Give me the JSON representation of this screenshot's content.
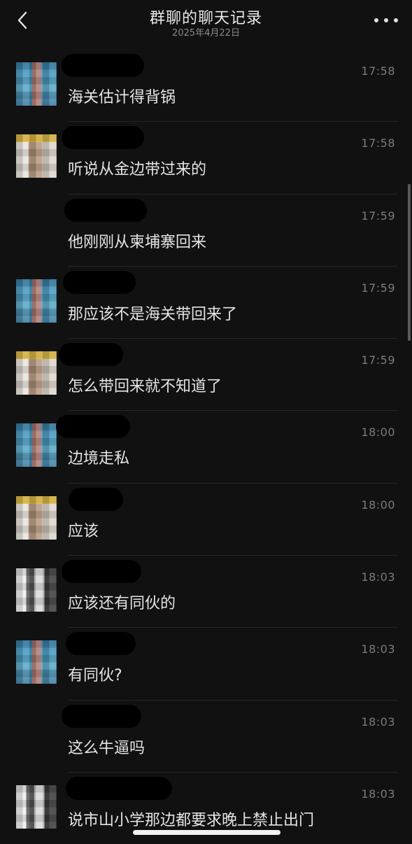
{
  "header": {
    "title": "群聊的聊天记录",
    "date": "2025年4月22日",
    "back_icon": "chevron-left-icon",
    "more_icon": "more-horizontal-icon"
  },
  "messages": [
    {
      "avatar": "blue",
      "time": "17:58",
      "text": "海关估计得背锅"
    },
    {
      "avatar": "tan",
      "time": "17:58",
      "text": "听说从金边带过来的"
    },
    {
      "avatar": "none",
      "time": "17:59",
      "text": "他刚刚从柬埔寨回来"
    },
    {
      "avatar": "blue",
      "time": "17:59",
      "text": "那应该不是海关带回来了"
    },
    {
      "avatar": "tan",
      "time": "17:59",
      "text": "怎么带回来就不知道了"
    },
    {
      "avatar": "blue",
      "time": "18:00",
      "text": "边境走私"
    },
    {
      "avatar": "tan",
      "time": "18:00",
      "text": "应该"
    },
    {
      "avatar": "gray",
      "time": "18:03",
      "text": "应该还有同伙的"
    },
    {
      "avatar": "blue",
      "time": "18:03",
      "text": "有同伙?"
    },
    {
      "avatar": "none",
      "time": "18:03",
      "text": "这么牛逼吗"
    },
    {
      "avatar": "gray",
      "time": "18:03",
      "text": "说市山小学那边都要求晚上禁止出门"
    }
  ],
  "colors": {
    "background": "#111111",
    "text": "#e4e4e4",
    "timestamp": "#7b7b7b"
  }
}
